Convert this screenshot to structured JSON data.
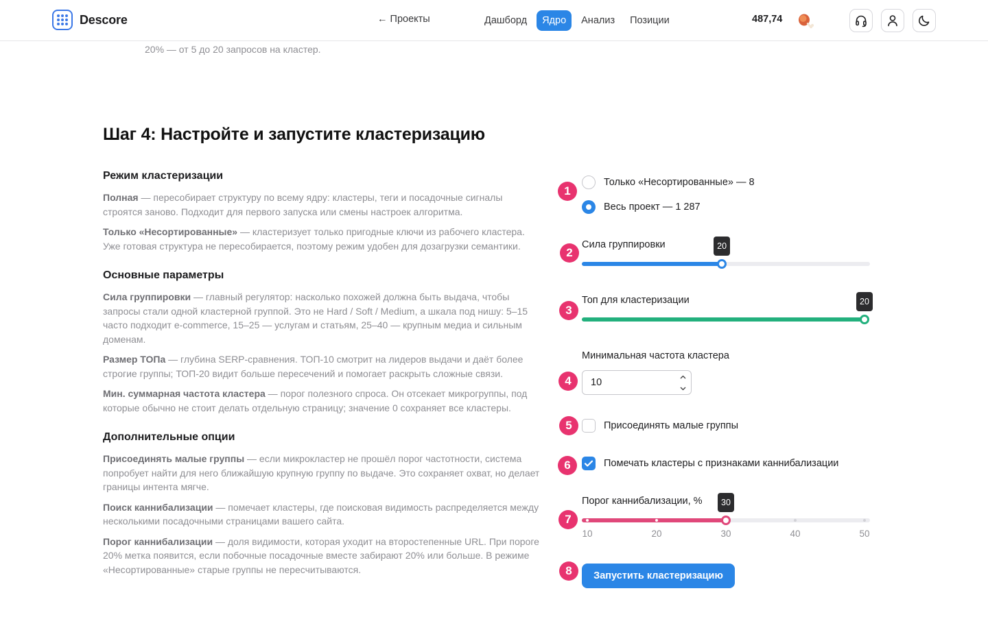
{
  "header": {
    "brand": "Descore",
    "back_link": "← Проекты",
    "nav": [
      {
        "label": "Дашборд",
        "active": false
      },
      {
        "label": "Ядро",
        "active": true
      },
      {
        "label": "Анализ",
        "active": false
      },
      {
        "label": "Позиции",
        "active": false
      }
    ],
    "balance": "487,74",
    "icons": [
      "coin-icon",
      "headphones-icon",
      "user-icon",
      "moon-icon"
    ]
  },
  "above_text": "20% — от 5 до 20 запросов на кластер.",
  "step_title": "Шаг 4: Настройте и запустите кластеризацию",
  "help": {
    "mode_title": "Режим кластеризации",
    "mode_full_term": "Полная",
    "mode_full_text": " — пересобирает структуру по всему ядру: кластеры, теги и посадочные сигналы строятся заново. Подходит для первого запуска или смены настроек алгоритма.",
    "mode_unsorted_term": "Только «Несортированные»",
    "mode_unsorted_text": " — кластеризует только пригодные ключи из рабочего кластера. Уже готовая структура не пересобирается, поэтому режим удобен для дозагрузки семантики.",
    "params_title": "Основные параметры",
    "strength_term": "Сила группировки",
    "strength_text": " — главный регулятор: насколько похожей должна быть выдача, чтобы запросы стали одной кластерной группой. Это не Hard / Soft / Medium, а шкала под нишу: 5–15 часто подходит e-commerce, 15–25 — услугам и статьям, 25–40 — крупным медиа и сильным доменам.",
    "top_term": "Размер ТОПа",
    "top_text": " — глубина SERP-сравнения. ТОП-10 смотрит на лидеров выдачи и даёт более строгие группы; ТОП-20 видит больше пересечений и помогает раскрыть сложные связи.",
    "minfreq_term": "Мин. суммарная частота кластера",
    "minfreq_text": " — порог полезного спроса. Он отсекает микрогруппы, под которые обычно не стоит делать отдельную страницу; значение 0 сохраняет все кластеры.",
    "extra_title": "Дополнительные опции",
    "join_term": "Присоединять малые группы",
    "join_text": " — если микрокластер не прошёл порог частотности, система попробует найти для него ближайшую крупную группу по выдаче. Это сохраняет охват, но делает границы интента мягче.",
    "cannib_term": "Поиск каннибализации",
    "cannib_text": " — помечает кластеры, где поисковая видимость распределяется между несколькими посадочными страницами вашего сайта.",
    "threshold_term": "Порог каннибализации",
    "threshold_text": " — доля видимости, которая уходит на второстепенные URL. При пороге 20% метка появится, если побочные посадочные вместе забирают 20% или больше. В режиме «Несортированные» старые группы не пересчитываются."
  },
  "settings": {
    "badges": [
      "1",
      "2",
      "3",
      "4",
      "5",
      "6",
      "7",
      "8"
    ],
    "mode_options": [
      {
        "label": "Только «Несортированные» — 8",
        "checked": false
      },
      {
        "label": "Весь проект — 1 287",
        "checked": true
      }
    ],
    "strength": {
      "label": "Сила группировки",
      "value": "20",
      "fraction": 0.486,
      "color": "#2b86e6"
    },
    "top": {
      "label": "Топ для кластеризации",
      "value": "20",
      "fraction": 1.0,
      "color": "#22b07d"
    },
    "min_freq": {
      "label": "Минимальная частота кластера",
      "value": "10"
    },
    "join_small": {
      "label": "Присоединять малые группы",
      "checked": false
    },
    "mark_cannib": {
      "label": "Помечать кластеры с признаками каннибализации",
      "checked": true
    },
    "threshold": {
      "label": "Порог каннибализации, %",
      "value": "30",
      "fraction": 0.5,
      "color": "#e0487a",
      "ticks": [
        "10",
        "20",
        "30",
        "40",
        "50"
      ]
    },
    "run_button": "Запустить кластеризацию"
  }
}
